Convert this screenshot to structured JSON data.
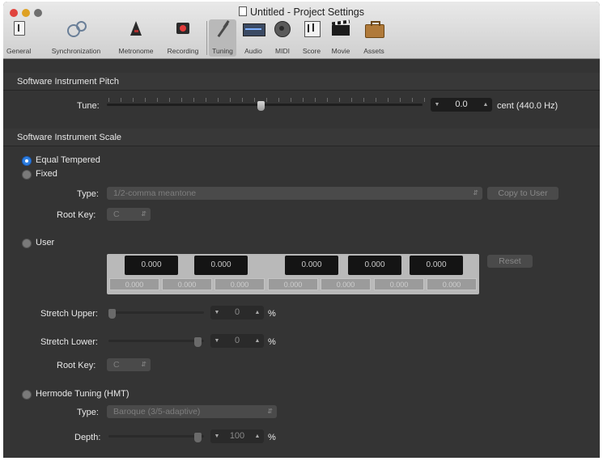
{
  "window": {
    "title": "Untitled - Project Settings"
  },
  "toolbar": {
    "items": [
      {
        "label": "General",
        "icon": "general-icon"
      },
      {
        "label": "Synchronization",
        "icon": "sync-icon"
      },
      {
        "label": "Metronome",
        "icon": "metronome-icon"
      },
      {
        "label": "Recording",
        "icon": "record-icon"
      },
      {
        "label": "Tuning",
        "icon": "tuning-fork-icon"
      },
      {
        "label": "Audio",
        "icon": "audio-icon"
      },
      {
        "label": "MIDI",
        "icon": "midi-icon"
      },
      {
        "label": "Score",
        "icon": "score-icon"
      },
      {
        "label": "Movie",
        "icon": "movie-icon"
      },
      {
        "label": "Assets",
        "icon": "assets-icon"
      }
    ],
    "selected": "Tuning"
  },
  "pitch": {
    "header": "Software Instrument Pitch",
    "tune_label": "Tune:",
    "tune_value": "0.0",
    "tune_unit": "cent (440.0 Hz)"
  },
  "scale": {
    "header": "Software Instrument Scale",
    "equal_label": "Equal Tempered",
    "fixed_label": "Fixed",
    "type_label": "Type:",
    "type_value": "1/2-comma meantone",
    "copy_button": "Copy to User",
    "rootkey_label": "Root Key:",
    "rootkey_value": "C",
    "user_label": "User",
    "black_values": [
      "0.000",
      "0.000",
      "0.000",
      "0.000",
      "0.000"
    ],
    "white_values": [
      "0.000",
      "0.000",
      "0.000",
      "0.000",
      "0.000",
      "0.000",
      "0.000"
    ],
    "reset_button": "Reset",
    "stretch_upper_label": "Stretch Upper:",
    "stretch_upper_value": "0",
    "stretch_lower_label": "Stretch Lower:",
    "stretch_lower_value": "0",
    "percent": "%",
    "user_rootkey_label": "Root Key:",
    "user_rootkey_value": "C",
    "hmt_label": "Hermode Tuning (HMT)",
    "hmt_type_label": "Type:",
    "hmt_type_value": "Baroque (3/5-adaptive)",
    "depth_label": "Depth:",
    "depth_value": "100"
  }
}
